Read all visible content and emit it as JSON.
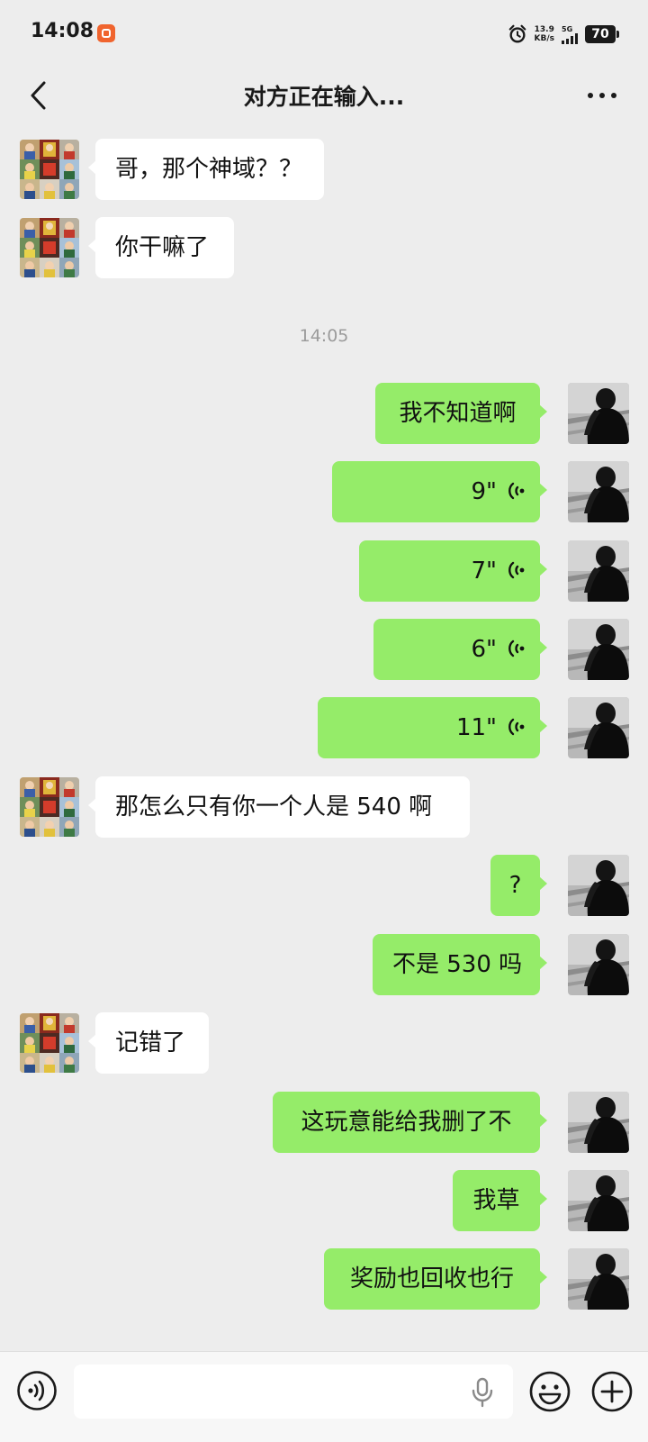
{
  "status_bar": {
    "time": "14:08",
    "net_speed_value": "13.9",
    "net_speed_unit": "KB/s",
    "network": "5G",
    "battery": "70"
  },
  "header": {
    "title": "对方正在输入..."
  },
  "messages": [
    {
      "from": "other",
      "type": "text",
      "text": "哥，那个神域？？"
    },
    {
      "from": "other",
      "type": "text",
      "text": "你干嘛了"
    },
    {
      "type": "time",
      "text": "14:05"
    },
    {
      "from": "me",
      "type": "text",
      "text": "我不知道啊"
    },
    {
      "from": "me",
      "type": "voice",
      "text": "9\""
    },
    {
      "from": "me",
      "type": "voice",
      "text": "7\""
    },
    {
      "from": "me",
      "type": "voice",
      "text": "6\""
    },
    {
      "from": "me",
      "type": "voice",
      "text": "11\""
    },
    {
      "from": "other",
      "type": "text",
      "text": "那怎么只有你一个人是 540 啊"
    },
    {
      "from": "me",
      "type": "text",
      "text": "?"
    },
    {
      "from": "me",
      "type": "text",
      "text": "不是 530 吗"
    },
    {
      "from": "other",
      "type": "text",
      "text": "记错了"
    },
    {
      "from": "me",
      "type": "text",
      "text": "这玩意能给我删了不"
    },
    {
      "from": "me",
      "type": "text",
      "text": "我草"
    },
    {
      "from": "me",
      "type": "text",
      "text": "奖励也回收也行"
    }
  ],
  "input": {
    "value": ""
  },
  "colors": {
    "background": "#ededed",
    "my_bubble": "#95ec69",
    "their_bubble": "#ffffff",
    "timestamp": "#9b9b9b"
  }
}
